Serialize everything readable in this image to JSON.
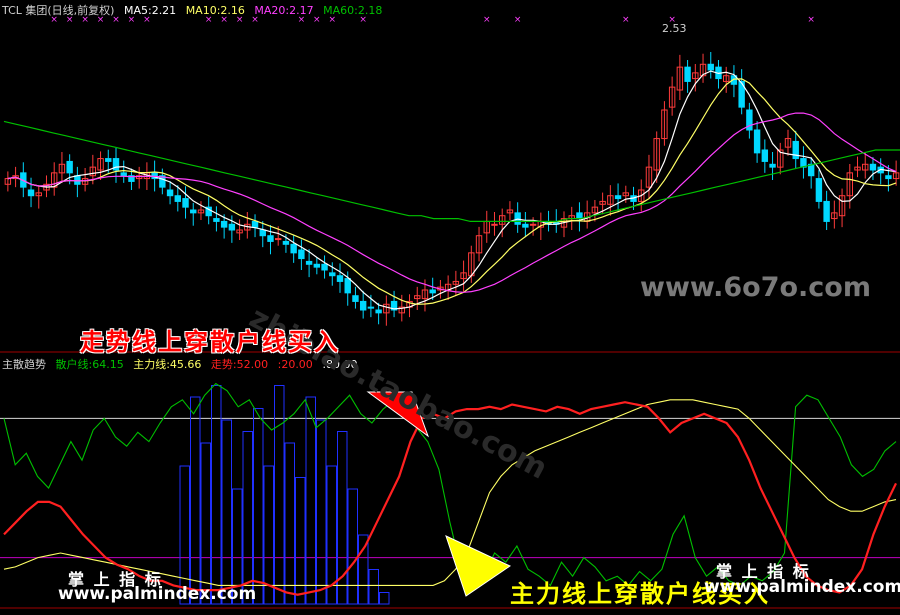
{
  "header_top": {
    "title": "TCL 集团(日线,前复权)",
    "ma5": "MA5:2.21",
    "ma10": "MA10:2.16",
    "ma20": "MA20:2.17",
    "ma60": "MA60:2.18"
  },
  "header_bottom": {
    "title": "主散趋势",
    "retail": "散户线:64.15",
    "main": "主力线:45.66",
    "trend": "走势:52.00",
    "lvl20": ":20.00",
    "lvl80": ":80.00"
  },
  "colors": {
    "background": "#000000",
    "up_candle": "#ff3b3b",
    "down_candle": "#00d8ff",
    "ma5": "#ffffff",
    "ma10": "#ffff66",
    "ma20": "#ff40ff",
    "ma60": "#00c000",
    "retail_line": "#00c000",
    "main_line": "#ffff66",
    "trend_line": "#ff2020",
    "volume_bars": "#2030ff"
  },
  "price_peak_label": "2.53",
  "annotations": {
    "buy_signal": "走势线上穿散户线买入",
    "main_cross": "主力线上穿散户线买入",
    "palm_left": "掌 上 指 标",
    "palm_right": "掌 上 指 标"
  },
  "watermarks": {
    "site_6070": "www.6o7o.com",
    "site_palm_left": "www.palmindex.com",
    "site_palm_right": "www.palmindex.com",
    "taobao": "zhibiao.taobao.com"
  },
  "chart_data": [
    {
      "type": "candlestick",
      "title": "TCL 集团(日线,前复权)",
      "series_lines": [
        "MA5",
        "MA10",
        "MA20",
        "MA60"
      ],
      "ylim": [
        1.55,
        2.6
      ],
      "peak_value": 2.53,
      "close": [
        2.08,
        2.09,
        2.05,
        2.02,
        2.03,
        2.06,
        2.1,
        2.13,
        2.1,
        2.06,
        2.08,
        2.12,
        2.15,
        2.14,
        2.11,
        2.09,
        2.07,
        2.09,
        2.1,
        2.08,
        2.05,
        2.02,
        2.0,
        1.98,
        1.96,
        1.97,
        1.95,
        1.93,
        1.91,
        1.9,
        1.9,
        1.92,
        1.91,
        1.88,
        1.86,
        1.87,
        1.85,
        1.82,
        1.8,
        1.78,
        1.77,
        1.76,
        1.74,
        1.72,
        1.68,
        1.65,
        1.62,
        1.63,
        1.61,
        1.64,
        1.62,
        1.63,
        1.65,
        1.67,
        1.69,
        1.68,
        1.7,
        1.71,
        1.72,
        1.75,
        1.82,
        1.88,
        1.93,
        1.92,
        1.95,
        1.97,
        1.92,
        1.91,
        1.92,
        1.93,
        1.92,
        1.92,
        1.94,
        1.95,
        1.94,
        1.96,
        1.98,
        2.0,
        2.02,
        2.01,
        2.03,
        2.0,
        2.04,
        2.12,
        2.22,
        2.32,
        2.4,
        2.47,
        2.42,
        2.45,
        2.48,
        2.46,
        2.43,
        2.44,
        2.41,
        2.33,
        2.25,
        2.17,
        2.14,
        2.12,
        2.18,
        2.22,
        2.15,
        2.12,
        2.09,
        2.0,
        1.93,
        1.96,
        2.02,
        2.1,
        2.12,
        2.13,
        2.11,
        2.1,
        2.08,
        2.1
      ],
      "ma60": [
        2.28,
        2.27,
        2.26,
        2.25,
        2.24,
        2.23,
        2.22,
        2.21,
        2.2,
        2.19,
        2.18,
        2.17,
        2.16,
        2.15,
        2.14,
        2.13,
        2.12,
        2.11,
        2.1,
        2.09,
        2.08,
        2.07,
        2.06,
        2.05,
        2.04,
        2.03,
        2.02,
        2.01,
        2.0,
        1.99,
        1.98,
        1.97,
        1.96,
        1.95,
        1.95,
        1.94,
        1.94,
        1.94,
        1.93,
        1.93,
        1.93,
        1.93,
        1.93,
        1.93,
        1.93,
        1.93,
        1.94,
        1.94,
        1.95,
        1.96,
        1.97,
        1.98,
        1.99,
        2.0,
        2.01,
        2.02,
        2.03,
        2.04,
        2.05,
        2.06,
        2.07,
        2.08,
        2.09,
        2.1,
        2.11,
        2.12,
        2.13,
        2.14,
        2.15,
        2.16,
        2.17,
        2.18,
        2.18,
        2.18
      ]
    },
    {
      "type": "line",
      "title": "主散趋势",
      "series": [
        {
          "name": "散户线",
          "values": [
            80,
            60,
            65,
            55,
            50,
            60,
            70,
            62,
            75,
            80,
            72,
            68,
            74,
            70,
            78,
            85,
            88,
            82,
            90,
            95,
            92,
            85,
            88,
            80,
            75,
            78,
            82,
            88,
            76,
            80,
            85,
            90,
            82,
            78,
            84,
            88,
            80,
            76,
            70,
            58,
            35,
            15,
            10,
            12,
            22,
            18,
            25,
            15,
            12,
            8,
            18,
            12,
            20,
            16,
            10,
            12,
            8,
            14,
            10,
            15,
            30,
            38,
            20,
            12,
            16,
            10,
            8,
            12,
            10,
            14,
            22,
            85,
            90,
            88,
            80,
            72,
            60,
            55,
            58,
            66,
            70
          ]
        },
        {
          "name": "主力线",
          "values": [
            15,
            16,
            18,
            20,
            21,
            22,
            21,
            20,
            19,
            18,
            17,
            16,
            15,
            14,
            13,
            12,
            11,
            10,
            9,
            8,
            8,
            8,
            8,
            8,
            8,
            8,
            8,
            8,
            8,
            8,
            8,
            8,
            8,
            8,
            8,
            8,
            8,
            8,
            8,
            10,
            15,
            22,
            35,
            48,
            55,
            60,
            63,
            66,
            68,
            70,
            72,
            74,
            76,
            78,
            80,
            82,
            84,
            86,
            87,
            88,
            88,
            88,
            87,
            86,
            85,
            84,
            80,
            75,
            70,
            65,
            60,
            55,
            50,
            45,
            42,
            40,
            40,
            42,
            44,
            45
          ]
        },
        {
          "name": "走势",
          "values": [
            30,
            35,
            40,
            44,
            44,
            42,
            36,
            30,
            25,
            20,
            17,
            15,
            12,
            10,
            10,
            8,
            7,
            6,
            6,
            6,
            7,
            8,
            10,
            9,
            7,
            5,
            4,
            5,
            6,
            8,
            12,
            18,
            25,
            35,
            45,
            55,
            70,
            80,
            82,
            80,
            83,
            84,
            84,
            85,
            84,
            86,
            85,
            84,
            83,
            85,
            84,
            82,
            84,
            85,
            86,
            87,
            86,
            85,
            80,
            74,
            78,
            80,
            82,
            80,
            78,
            72,
            62,
            50,
            40,
            30,
            20,
            12,
            8,
            6,
            5,
            8,
            15,
            30,
            42,
            52
          ]
        }
      ],
      "reference_levels": [
        20,
        80
      ],
      "ylim": [
        0,
        100
      ]
    }
  ]
}
